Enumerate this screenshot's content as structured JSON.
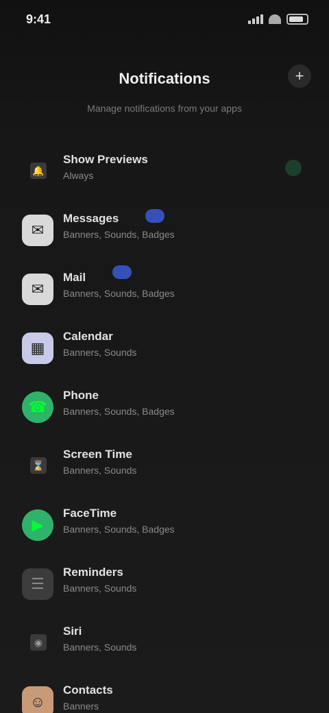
{
  "status_bar": {
    "time": "9:41",
    "battery_pct": 0.7
  },
  "nav": {
    "title": "Notifications",
    "action_icon": "plus-icon",
    "action_glyph": "+"
  },
  "subtitle": "Manage notifications from your apps",
  "items": [
    {
      "title": "Show Previews",
      "detail": "Always",
      "icon": "bell-icon",
      "glyph": "🔔",
      "style": "small",
      "toggle": true
    },
    {
      "title": "Messages",
      "detail": "Banners, Sounds, Badges",
      "icon": "messages-icon",
      "glyph": "✉",
      "style": "grey",
      "badge": true
    },
    {
      "title": "Mail",
      "detail": "Banners, Sounds, Badges",
      "icon": "mail-icon",
      "glyph": "✉",
      "style": "grey",
      "badge": true
    },
    {
      "title": "Calendar",
      "detail": "Banners, Sounds",
      "icon": "calendar-icon",
      "glyph": "▦",
      "style": "lav"
    },
    {
      "title": "Phone",
      "detail": "Banners, Sounds, Badges",
      "icon": "phone-icon",
      "glyph": "☎",
      "style": "green"
    },
    {
      "title": "Screen Time",
      "detail": "Banners, Sounds",
      "icon": "hourglass-icon",
      "glyph": "⌛",
      "style": "small"
    },
    {
      "title": "FaceTime",
      "detail": "Banners, Sounds, Badges",
      "icon": "video-icon",
      "glyph": "▶",
      "style": "green"
    },
    {
      "title": "Reminders",
      "detail": "Banners, Sounds",
      "icon": "list-icon",
      "glyph": "☰",
      "style": "dark"
    },
    {
      "title": "Siri",
      "detail": "Banners, Sounds",
      "icon": "siri-icon",
      "glyph": "◉",
      "style": "small"
    },
    {
      "title": "Contacts",
      "detail": "Banners",
      "icon": "contacts-icon",
      "glyph": "☺",
      "style": "orange"
    }
  ]
}
